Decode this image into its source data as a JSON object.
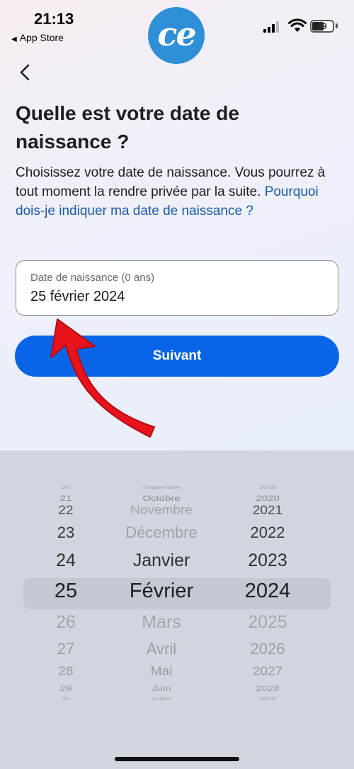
{
  "status": {
    "time": "21:13",
    "back_app": "App Store",
    "battery": "39"
  },
  "brand": {
    "logo_text": "ce"
  },
  "page": {
    "title": "Quelle est votre date de naissance ?",
    "description": "Choisissez votre date de naissance. Vous pourrez à tout moment la rendre privée par la suite. ",
    "description_link": "Pourquoi dois-je indiquer ma date de naissance ?"
  },
  "date_field": {
    "label": "Date de naissance (0 ans)",
    "value": "25 février 2024"
  },
  "next_button": {
    "label": "Suivant"
  },
  "picker": {
    "days": [
      "20",
      "21",
      "22",
      "23",
      "24",
      "25",
      "26",
      "27",
      "28",
      "29",
      "30"
    ],
    "months": [
      "Septembre",
      "Octobre",
      "Novembre",
      "Décembre",
      "Janvier",
      "Février",
      "Mars",
      "Avril",
      "Mai",
      "Juin",
      "Juillet"
    ],
    "years": [
      "2019",
      "2020",
      "2021",
      "2022",
      "2023",
      "2024",
      "2025",
      "2026",
      "2027",
      "2028",
      "2029"
    ],
    "selected": {
      "day": "25",
      "month": "Février",
      "year": "2024"
    }
  },
  "colors": {
    "accent": "#0865e8",
    "link": "#1a5aa6",
    "logo": "#2f8fd7",
    "annotation_arrow": "#e8121c"
  }
}
